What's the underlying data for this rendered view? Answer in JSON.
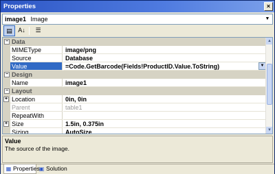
{
  "window": {
    "title": "Properties",
    "close_glyph": "×"
  },
  "object_selector": {
    "name": "image1",
    "type": "Image"
  },
  "toolbar": {
    "buttons": [
      {
        "name": "categorized-icon",
        "glyph": "▤"
      },
      {
        "name": "alphabetical-icon",
        "glyph": "A↓"
      },
      {
        "name": "property-pages-icon",
        "glyph": "☰"
      }
    ]
  },
  "grid": {
    "rows": [
      {
        "kind": "category",
        "toggle": "−",
        "label": "Data"
      },
      {
        "kind": "property",
        "name": "MIMEType",
        "value": "image/png"
      },
      {
        "kind": "property",
        "name": "Source",
        "value": "Database"
      },
      {
        "kind": "property",
        "name": "Value",
        "value": "=Code.GetBarcode(Fields!ProductID.Value.ToString)",
        "selected": true
      },
      {
        "kind": "category",
        "toggle": "−",
        "label": "Design"
      },
      {
        "kind": "property",
        "name": "Name",
        "value": "image1"
      },
      {
        "kind": "category",
        "toggle": "−",
        "label": "Layout"
      },
      {
        "kind": "property",
        "name": "Location",
        "value": "0in, 0in",
        "expander": "+"
      },
      {
        "kind": "property",
        "name": "Parent",
        "value": "table1",
        "disabled": true
      },
      {
        "kind": "property",
        "name": "RepeatWith",
        "value": ""
      },
      {
        "kind": "property",
        "name": "Size",
        "value": "1.5in, 0.375in",
        "expander": "+"
      },
      {
        "kind": "property",
        "name": "Sizing",
        "value": "AutoSize"
      }
    ]
  },
  "description": {
    "title": "Value",
    "text": "The source of the image."
  },
  "tabs": [
    {
      "label": "Properties",
      "active": true
    },
    {
      "label": "Solution Explorer",
      "active": false
    }
  ],
  "colors": {
    "titlebar": "#2e57c5",
    "selection": "#316ac5",
    "category": "#d6d3c4"
  }
}
